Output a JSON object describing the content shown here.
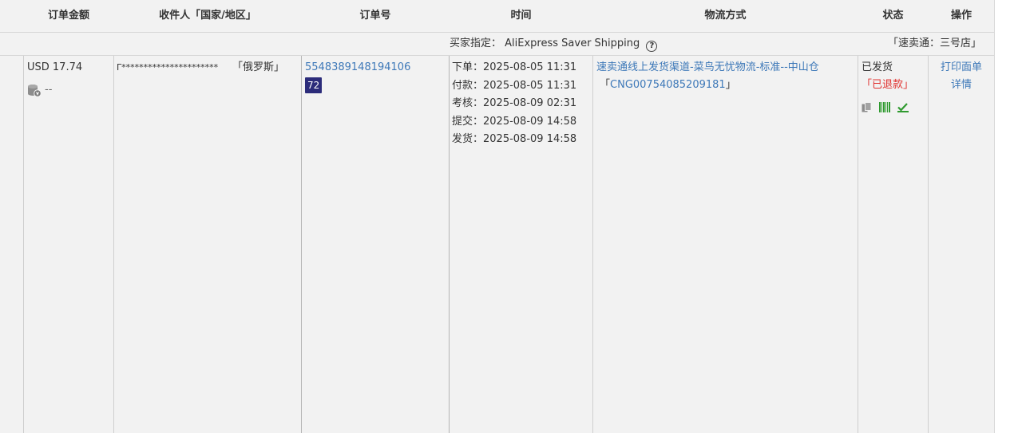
{
  "header": {
    "amount": "订单金额",
    "recipient": "收件人「国家/地区」",
    "order_no": "订单号",
    "time": "时间",
    "logistics": "物流方式",
    "status": "状态",
    "actions": "操作"
  },
  "meta": {
    "buyer_label": "买家指定：",
    "buyer_shipping": "AliExpress Saver Shipping",
    "help_glyph": "?",
    "store": "「速卖通：三号店」"
  },
  "order": {
    "amount": "USD 17.74",
    "amount_sub": "--",
    "recipient_name": "Γ**********************",
    "country": "「俄罗斯」",
    "order_no": "5548389148194106",
    "badge": "72",
    "times": [
      {
        "label": "下单：",
        "value": "2025-08-05 11:31"
      },
      {
        "label": "付款：",
        "value": "2025-08-05 11:31"
      },
      {
        "label": "考核：",
        "value": "2025-08-09 02:31"
      },
      {
        "label": "提交：",
        "value": "2025-08-09 14:58"
      },
      {
        "label": "发货：",
        "value": "2025-08-09 14:58"
      }
    ],
    "logistics_channel": "速卖通线上发货渠道-菜鸟无忧物流-标准--中山仓",
    "tracking_open": "「",
    "tracking_no": "CNG00754085209181",
    "tracking_close": "」",
    "status_main": "已发货",
    "status_refund": "「已退款」",
    "actions": {
      "print": "打印面单",
      "detail": "详情"
    }
  },
  "colors": {
    "link": "#3d78b8",
    "refund": "#e0312e",
    "badge": "#2c2c7a",
    "icon_green": "#2f9a2f"
  },
  "icons": {
    "coin": "coin-stack-icon",
    "copy": "copy-icon",
    "barcode": "barcode-icon",
    "check": "check-sign-icon"
  }
}
